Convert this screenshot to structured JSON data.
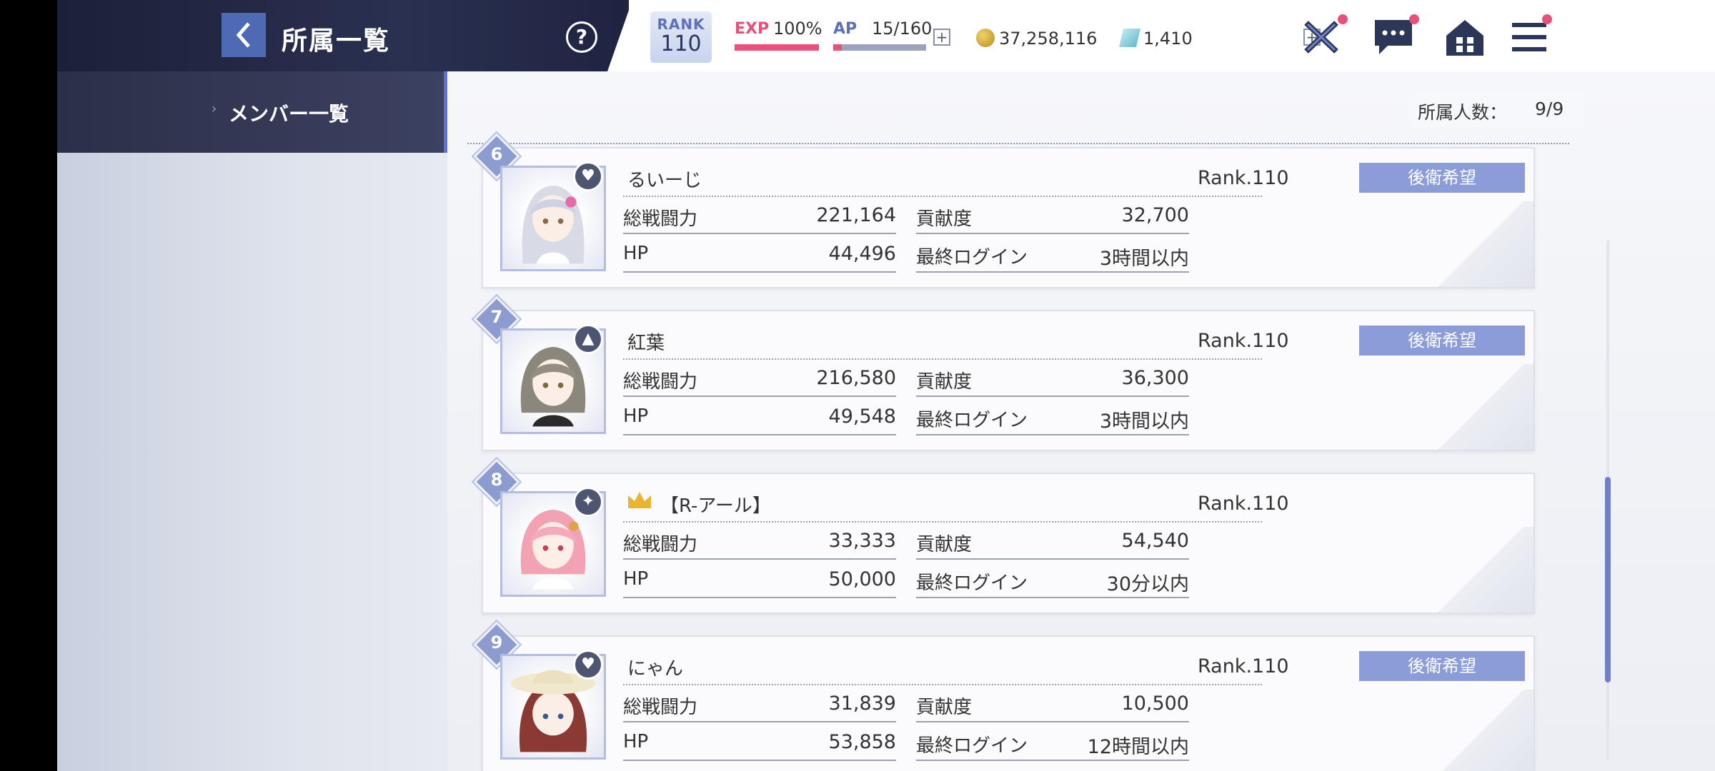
{
  "header": {
    "title": "所属一覧",
    "help_label": "?",
    "rank_label": "RANK",
    "rank_value": "110",
    "exp_label": "EXP",
    "exp_value": "100%",
    "exp_progress": 1.0,
    "ap_label": "AP",
    "ap_value": "15/160",
    "ap_progress": 0.09,
    "plus_label": "+",
    "gold_value": "37,258,116",
    "gem_value": "1,410",
    "icons": [
      "battle-icon",
      "chat-icon",
      "home-icon",
      "menu-icon"
    ]
  },
  "sidebar": {
    "items": [
      {
        "label": "メンバー一覧",
        "selected": true
      }
    ]
  },
  "main": {
    "member_count_label": "所属人数：",
    "member_count_value": "9/9"
  },
  "members": [
    {
      "number": "6",
      "name": "るいーじ",
      "rank": "Rank.110",
      "combat_label": "総戦闘力",
      "combat": "221,164",
      "contrib_label": "貢献度",
      "contrib": "32,700",
      "hp_label": "HP",
      "hp": "44,496",
      "login_label": "最終ログイン",
      "login": "3時間以内",
      "tag": "後衛希望",
      "role_icon": "heart-plus-icon"
    },
    {
      "number": "7",
      "name": "紅葉",
      "rank": "Rank.110",
      "combat_label": "総戦闘力",
      "combat": "216,580",
      "contrib_label": "貢献度",
      "contrib": "36,300",
      "hp_label": "HP",
      "hp": "49,548",
      "login_label": "最終ログイン",
      "login": "3時間以内",
      "tag": "後衛希望",
      "role_icon": "arrow-up-icon"
    },
    {
      "number": "8",
      "name": "【R-アール】",
      "rank": "Rank.110",
      "combat_label": "総戦闘力",
      "combat": "33,333",
      "contrib_label": "貢献度",
      "contrib": "54,540",
      "hp_label": "HP",
      "hp": "50,000",
      "login_label": "最終ログイン",
      "login": "30分以内",
      "tag": "",
      "role_icon": "sparkle-icon",
      "leader": true
    },
    {
      "number": "9",
      "name": "にゃん",
      "rank": "Rank.110",
      "combat_label": "総戦闘力",
      "combat": "31,839",
      "contrib_label": "貢献度",
      "contrib": "10,500",
      "hp_label": "HP",
      "hp": "53,858",
      "login_label": "最終ログイン",
      "login": "12時間以内",
      "tag": "後衛希望",
      "role_icon": "heart-plus-icon"
    }
  ],
  "colors": {
    "accent": "#5b72d5",
    "exp": "#e8507a",
    "tag": "#8c9cd8",
    "notify": "#e8507a"
  }
}
